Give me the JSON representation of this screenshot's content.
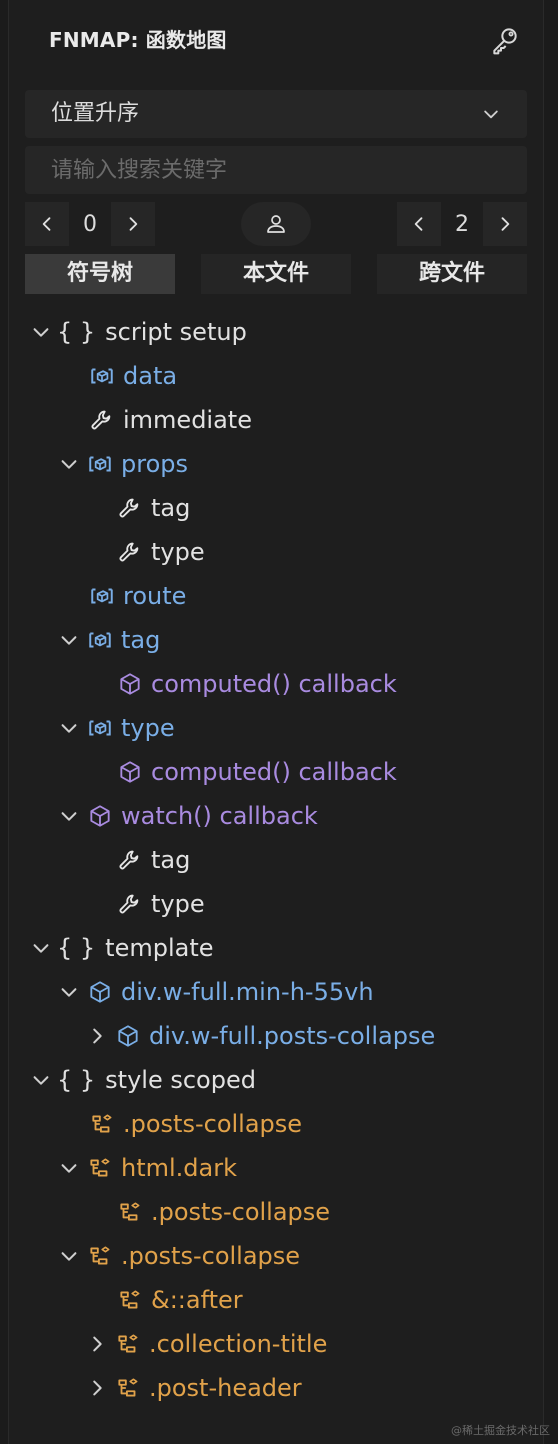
{
  "header": {
    "title": "FNMAP: 函数地图"
  },
  "sort_select": {
    "value": "位置升序"
  },
  "search": {
    "placeholder": "请输入搜索关键字"
  },
  "pager_left": {
    "value": "0"
  },
  "pager_right": {
    "value": "2"
  },
  "tabs": [
    "符号树",
    "本文件",
    "跨文件"
  ],
  "tree": {
    "script_setup": "script setup",
    "data": "data",
    "immediate": "immediate",
    "props": "props",
    "props_tag": "tag",
    "props_type": "type",
    "route": "route",
    "tag": "tag",
    "tag_computed": "computed() callback",
    "type": "type",
    "type_computed": "computed() callback",
    "watch": "watch() callback",
    "watch_tag": "tag",
    "watch_type": "type",
    "template": "template",
    "div_main": "div.w-full.min-h-55vh",
    "div_posts": "div.w-full.posts-collapse",
    "style_scoped": "style scoped",
    "sel_posts_collapse": ".posts-collapse",
    "sel_html_dark": "html.dark",
    "sel_dark_posts_collapse": ".posts-collapse",
    "sel_posts_collapse_2": ".posts-collapse",
    "sel_after": "&::after",
    "sel_collection_title": ".collection-title",
    "sel_post_header": ".post-header"
  },
  "colors": {
    "variable": "#7aaee6",
    "property": "#e2e2e2",
    "callback": "#a98be0",
    "selector": "#e1a24a"
  },
  "watermark": "@稀土掘金技术社区"
}
